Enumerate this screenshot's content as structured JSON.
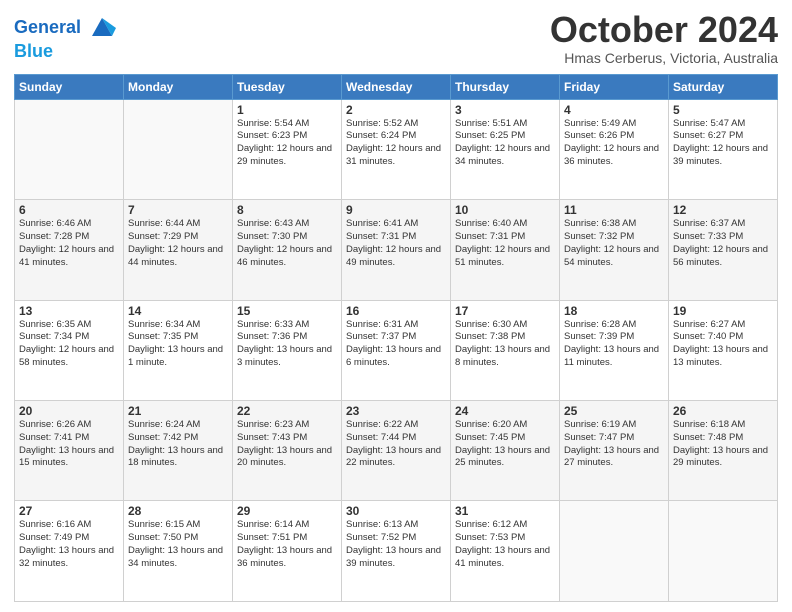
{
  "header": {
    "logo_line1": "General",
    "logo_line2": "Blue",
    "month": "October 2024",
    "location": "Hmas Cerberus, Victoria, Australia"
  },
  "weekdays": [
    "Sunday",
    "Monday",
    "Tuesday",
    "Wednesday",
    "Thursday",
    "Friday",
    "Saturday"
  ],
  "weeks": [
    [
      {
        "day": "",
        "sunrise": "",
        "sunset": "",
        "daylight": ""
      },
      {
        "day": "",
        "sunrise": "",
        "sunset": "",
        "daylight": ""
      },
      {
        "day": "1",
        "sunrise": "Sunrise: 5:54 AM",
        "sunset": "Sunset: 6:23 PM",
        "daylight": "Daylight: 12 hours and 29 minutes."
      },
      {
        "day": "2",
        "sunrise": "Sunrise: 5:52 AM",
        "sunset": "Sunset: 6:24 PM",
        "daylight": "Daylight: 12 hours and 31 minutes."
      },
      {
        "day": "3",
        "sunrise": "Sunrise: 5:51 AM",
        "sunset": "Sunset: 6:25 PM",
        "daylight": "Daylight: 12 hours and 34 minutes."
      },
      {
        "day": "4",
        "sunrise": "Sunrise: 5:49 AM",
        "sunset": "Sunset: 6:26 PM",
        "daylight": "Daylight: 12 hours and 36 minutes."
      },
      {
        "day": "5",
        "sunrise": "Sunrise: 5:47 AM",
        "sunset": "Sunset: 6:27 PM",
        "daylight": "Daylight: 12 hours and 39 minutes."
      }
    ],
    [
      {
        "day": "6",
        "sunrise": "Sunrise: 6:46 AM",
        "sunset": "Sunset: 7:28 PM",
        "daylight": "Daylight: 12 hours and 41 minutes."
      },
      {
        "day": "7",
        "sunrise": "Sunrise: 6:44 AM",
        "sunset": "Sunset: 7:29 PM",
        "daylight": "Daylight: 12 hours and 44 minutes."
      },
      {
        "day": "8",
        "sunrise": "Sunrise: 6:43 AM",
        "sunset": "Sunset: 7:30 PM",
        "daylight": "Daylight: 12 hours and 46 minutes."
      },
      {
        "day": "9",
        "sunrise": "Sunrise: 6:41 AM",
        "sunset": "Sunset: 7:31 PM",
        "daylight": "Daylight: 12 hours and 49 minutes."
      },
      {
        "day": "10",
        "sunrise": "Sunrise: 6:40 AM",
        "sunset": "Sunset: 7:31 PM",
        "daylight": "Daylight: 12 hours and 51 minutes."
      },
      {
        "day": "11",
        "sunrise": "Sunrise: 6:38 AM",
        "sunset": "Sunset: 7:32 PM",
        "daylight": "Daylight: 12 hours and 54 minutes."
      },
      {
        "day": "12",
        "sunrise": "Sunrise: 6:37 AM",
        "sunset": "Sunset: 7:33 PM",
        "daylight": "Daylight: 12 hours and 56 minutes."
      }
    ],
    [
      {
        "day": "13",
        "sunrise": "Sunrise: 6:35 AM",
        "sunset": "Sunset: 7:34 PM",
        "daylight": "Daylight: 12 hours and 58 minutes."
      },
      {
        "day": "14",
        "sunrise": "Sunrise: 6:34 AM",
        "sunset": "Sunset: 7:35 PM",
        "daylight": "Daylight: 13 hours and 1 minute."
      },
      {
        "day": "15",
        "sunrise": "Sunrise: 6:33 AM",
        "sunset": "Sunset: 7:36 PM",
        "daylight": "Daylight: 13 hours and 3 minutes."
      },
      {
        "day": "16",
        "sunrise": "Sunrise: 6:31 AM",
        "sunset": "Sunset: 7:37 PM",
        "daylight": "Daylight: 13 hours and 6 minutes."
      },
      {
        "day": "17",
        "sunrise": "Sunrise: 6:30 AM",
        "sunset": "Sunset: 7:38 PM",
        "daylight": "Daylight: 13 hours and 8 minutes."
      },
      {
        "day": "18",
        "sunrise": "Sunrise: 6:28 AM",
        "sunset": "Sunset: 7:39 PM",
        "daylight": "Daylight: 13 hours and 11 minutes."
      },
      {
        "day": "19",
        "sunrise": "Sunrise: 6:27 AM",
        "sunset": "Sunset: 7:40 PM",
        "daylight": "Daylight: 13 hours and 13 minutes."
      }
    ],
    [
      {
        "day": "20",
        "sunrise": "Sunrise: 6:26 AM",
        "sunset": "Sunset: 7:41 PM",
        "daylight": "Daylight: 13 hours and 15 minutes."
      },
      {
        "day": "21",
        "sunrise": "Sunrise: 6:24 AM",
        "sunset": "Sunset: 7:42 PM",
        "daylight": "Daylight: 13 hours and 18 minutes."
      },
      {
        "day": "22",
        "sunrise": "Sunrise: 6:23 AM",
        "sunset": "Sunset: 7:43 PM",
        "daylight": "Daylight: 13 hours and 20 minutes."
      },
      {
        "day": "23",
        "sunrise": "Sunrise: 6:22 AM",
        "sunset": "Sunset: 7:44 PM",
        "daylight": "Daylight: 13 hours and 22 minutes."
      },
      {
        "day": "24",
        "sunrise": "Sunrise: 6:20 AM",
        "sunset": "Sunset: 7:45 PM",
        "daylight": "Daylight: 13 hours and 25 minutes."
      },
      {
        "day": "25",
        "sunrise": "Sunrise: 6:19 AM",
        "sunset": "Sunset: 7:47 PM",
        "daylight": "Daylight: 13 hours and 27 minutes."
      },
      {
        "day": "26",
        "sunrise": "Sunrise: 6:18 AM",
        "sunset": "Sunset: 7:48 PM",
        "daylight": "Daylight: 13 hours and 29 minutes."
      }
    ],
    [
      {
        "day": "27",
        "sunrise": "Sunrise: 6:16 AM",
        "sunset": "Sunset: 7:49 PM",
        "daylight": "Daylight: 13 hours and 32 minutes."
      },
      {
        "day": "28",
        "sunrise": "Sunrise: 6:15 AM",
        "sunset": "Sunset: 7:50 PM",
        "daylight": "Daylight: 13 hours and 34 minutes."
      },
      {
        "day": "29",
        "sunrise": "Sunrise: 6:14 AM",
        "sunset": "Sunset: 7:51 PM",
        "daylight": "Daylight: 13 hours and 36 minutes."
      },
      {
        "day": "30",
        "sunrise": "Sunrise: 6:13 AM",
        "sunset": "Sunset: 7:52 PM",
        "daylight": "Daylight: 13 hours and 39 minutes."
      },
      {
        "day": "31",
        "sunrise": "Sunrise: 6:12 AM",
        "sunset": "Sunset: 7:53 PM",
        "daylight": "Daylight: 13 hours and 41 minutes."
      },
      {
        "day": "",
        "sunrise": "",
        "sunset": "",
        "daylight": ""
      },
      {
        "day": "",
        "sunrise": "",
        "sunset": "",
        "daylight": ""
      }
    ]
  ]
}
